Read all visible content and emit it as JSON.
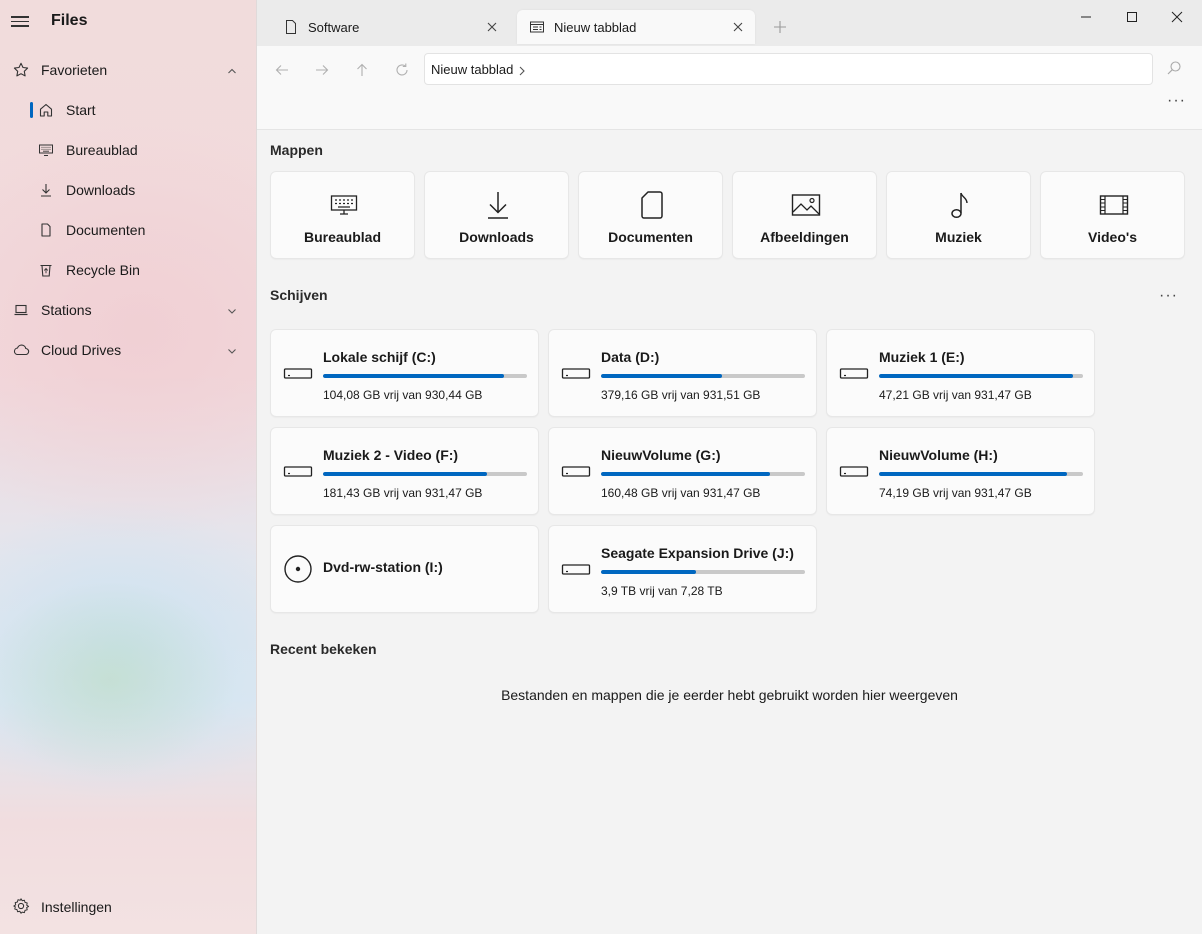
{
  "app": {
    "title": "Files"
  },
  "sidebar": {
    "groups": [
      {
        "label": "Favorieten",
        "icon": "star-icon",
        "expanded": true
      },
      {
        "label": "Stations",
        "icon": "laptop-icon",
        "expanded": false
      },
      {
        "label": "Cloud Drives",
        "icon": "cloud-icon",
        "expanded": false
      }
    ],
    "favorites": [
      {
        "label": "Start",
        "icon": "home-icon",
        "active": true
      },
      {
        "label": "Bureaublad",
        "icon": "desktop-icon"
      },
      {
        "label": "Downloads",
        "icon": "download-icon"
      },
      {
        "label": "Documenten",
        "icon": "document-icon"
      },
      {
        "label": "Recycle Bin",
        "icon": "recycle-bin-icon"
      }
    ],
    "settings_label": "Instellingen"
  },
  "tabs": [
    {
      "label": "Software",
      "icon": "document-icon",
      "active": false
    },
    {
      "label": "Nieuw tabblad",
      "icon": "new-tab-icon",
      "active": true
    }
  ],
  "address": {
    "crumb": "Nieuw tabblad"
  },
  "sections": {
    "folders_title": "Mappen",
    "drives_title": "Schijven",
    "recent_title": "Recent bekeken",
    "recent_empty": "Bestanden en mappen die je eerder hebt gebruikt worden hier weergeven"
  },
  "folders": [
    {
      "label": "Bureaublad",
      "icon": "desktop-icon"
    },
    {
      "label": "Downloads",
      "icon": "download-icon"
    },
    {
      "label": "Documenten",
      "icon": "document-icon"
    },
    {
      "label": "Afbeeldingen",
      "icon": "image-icon"
    },
    {
      "label": "Muziek",
      "icon": "music-icon"
    },
    {
      "label": "Video's",
      "icon": "video-icon"
    }
  ],
  "drives": [
    {
      "name": "Lokale schijf (C:)",
      "free": "104,08 GB vrij van 930,44 GB",
      "used_fraction": 0.888,
      "icon": "drive-icon"
    },
    {
      "name": "Data (D:)",
      "free": "379,16 GB vrij van 931,51 GB",
      "used_fraction": 0.593,
      "icon": "drive-icon"
    },
    {
      "name": "Muziek 1 (E:)",
      "free": "47,21 GB vrij van 931,47 GB",
      "used_fraction": 0.949,
      "icon": "drive-icon"
    },
    {
      "name": "Muziek 2 - Video (F:)",
      "free": "181,43 GB vrij van 931,47 GB",
      "used_fraction": 0.805,
      "icon": "drive-icon"
    },
    {
      "name": "NieuwVolume (G:)",
      "free": "160,48 GB vrij van 931,47 GB",
      "used_fraction": 0.828,
      "icon": "drive-icon"
    },
    {
      "name": "NieuwVolume (H:)",
      "free": "74,19 GB vrij van 931,47 GB",
      "used_fraction": 0.92,
      "icon": "drive-icon"
    },
    {
      "name": "Dvd-rw-station (I:)",
      "free": "",
      "used_fraction": null,
      "icon": "disc-icon"
    },
    {
      "name": "Seagate Expansion Drive (J:)",
      "free": "3,9 TB vrij van 7,28 TB",
      "used_fraction": 0.464,
      "icon": "drive-icon"
    }
  ],
  "colors": {
    "accent": "#0067c0",
    "bar_track": "#c9c9c9"
  }
}
